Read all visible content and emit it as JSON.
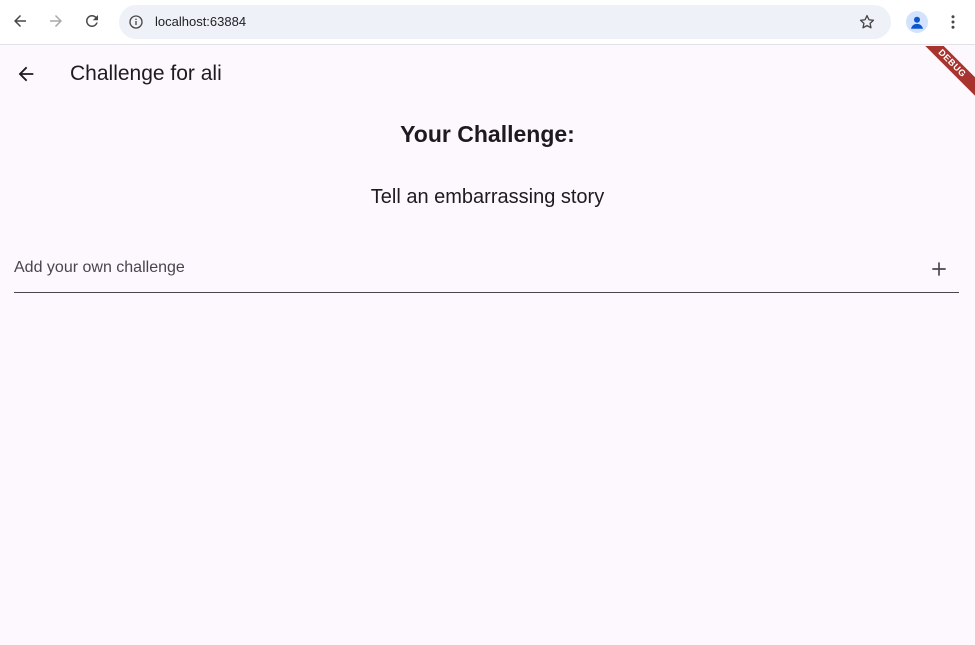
{
  "browser": {
    "url": "localhost:63884"
  },
  "app_bar": {
    "title": "Challenge for ali"
  },
  "debug_banner": "DEBUG",
  "main": {
    "heading": "Your Challenge:",
    "challenge": "Tell an embarrassing story",
    "input_placeholder": "Add your own challenge",
    "input_value": ""
  },
  "colors": {
    "background": "#fdf7fe",
    "text": "#1d1b20",
    "debug": "#a8342f"
  }
}
